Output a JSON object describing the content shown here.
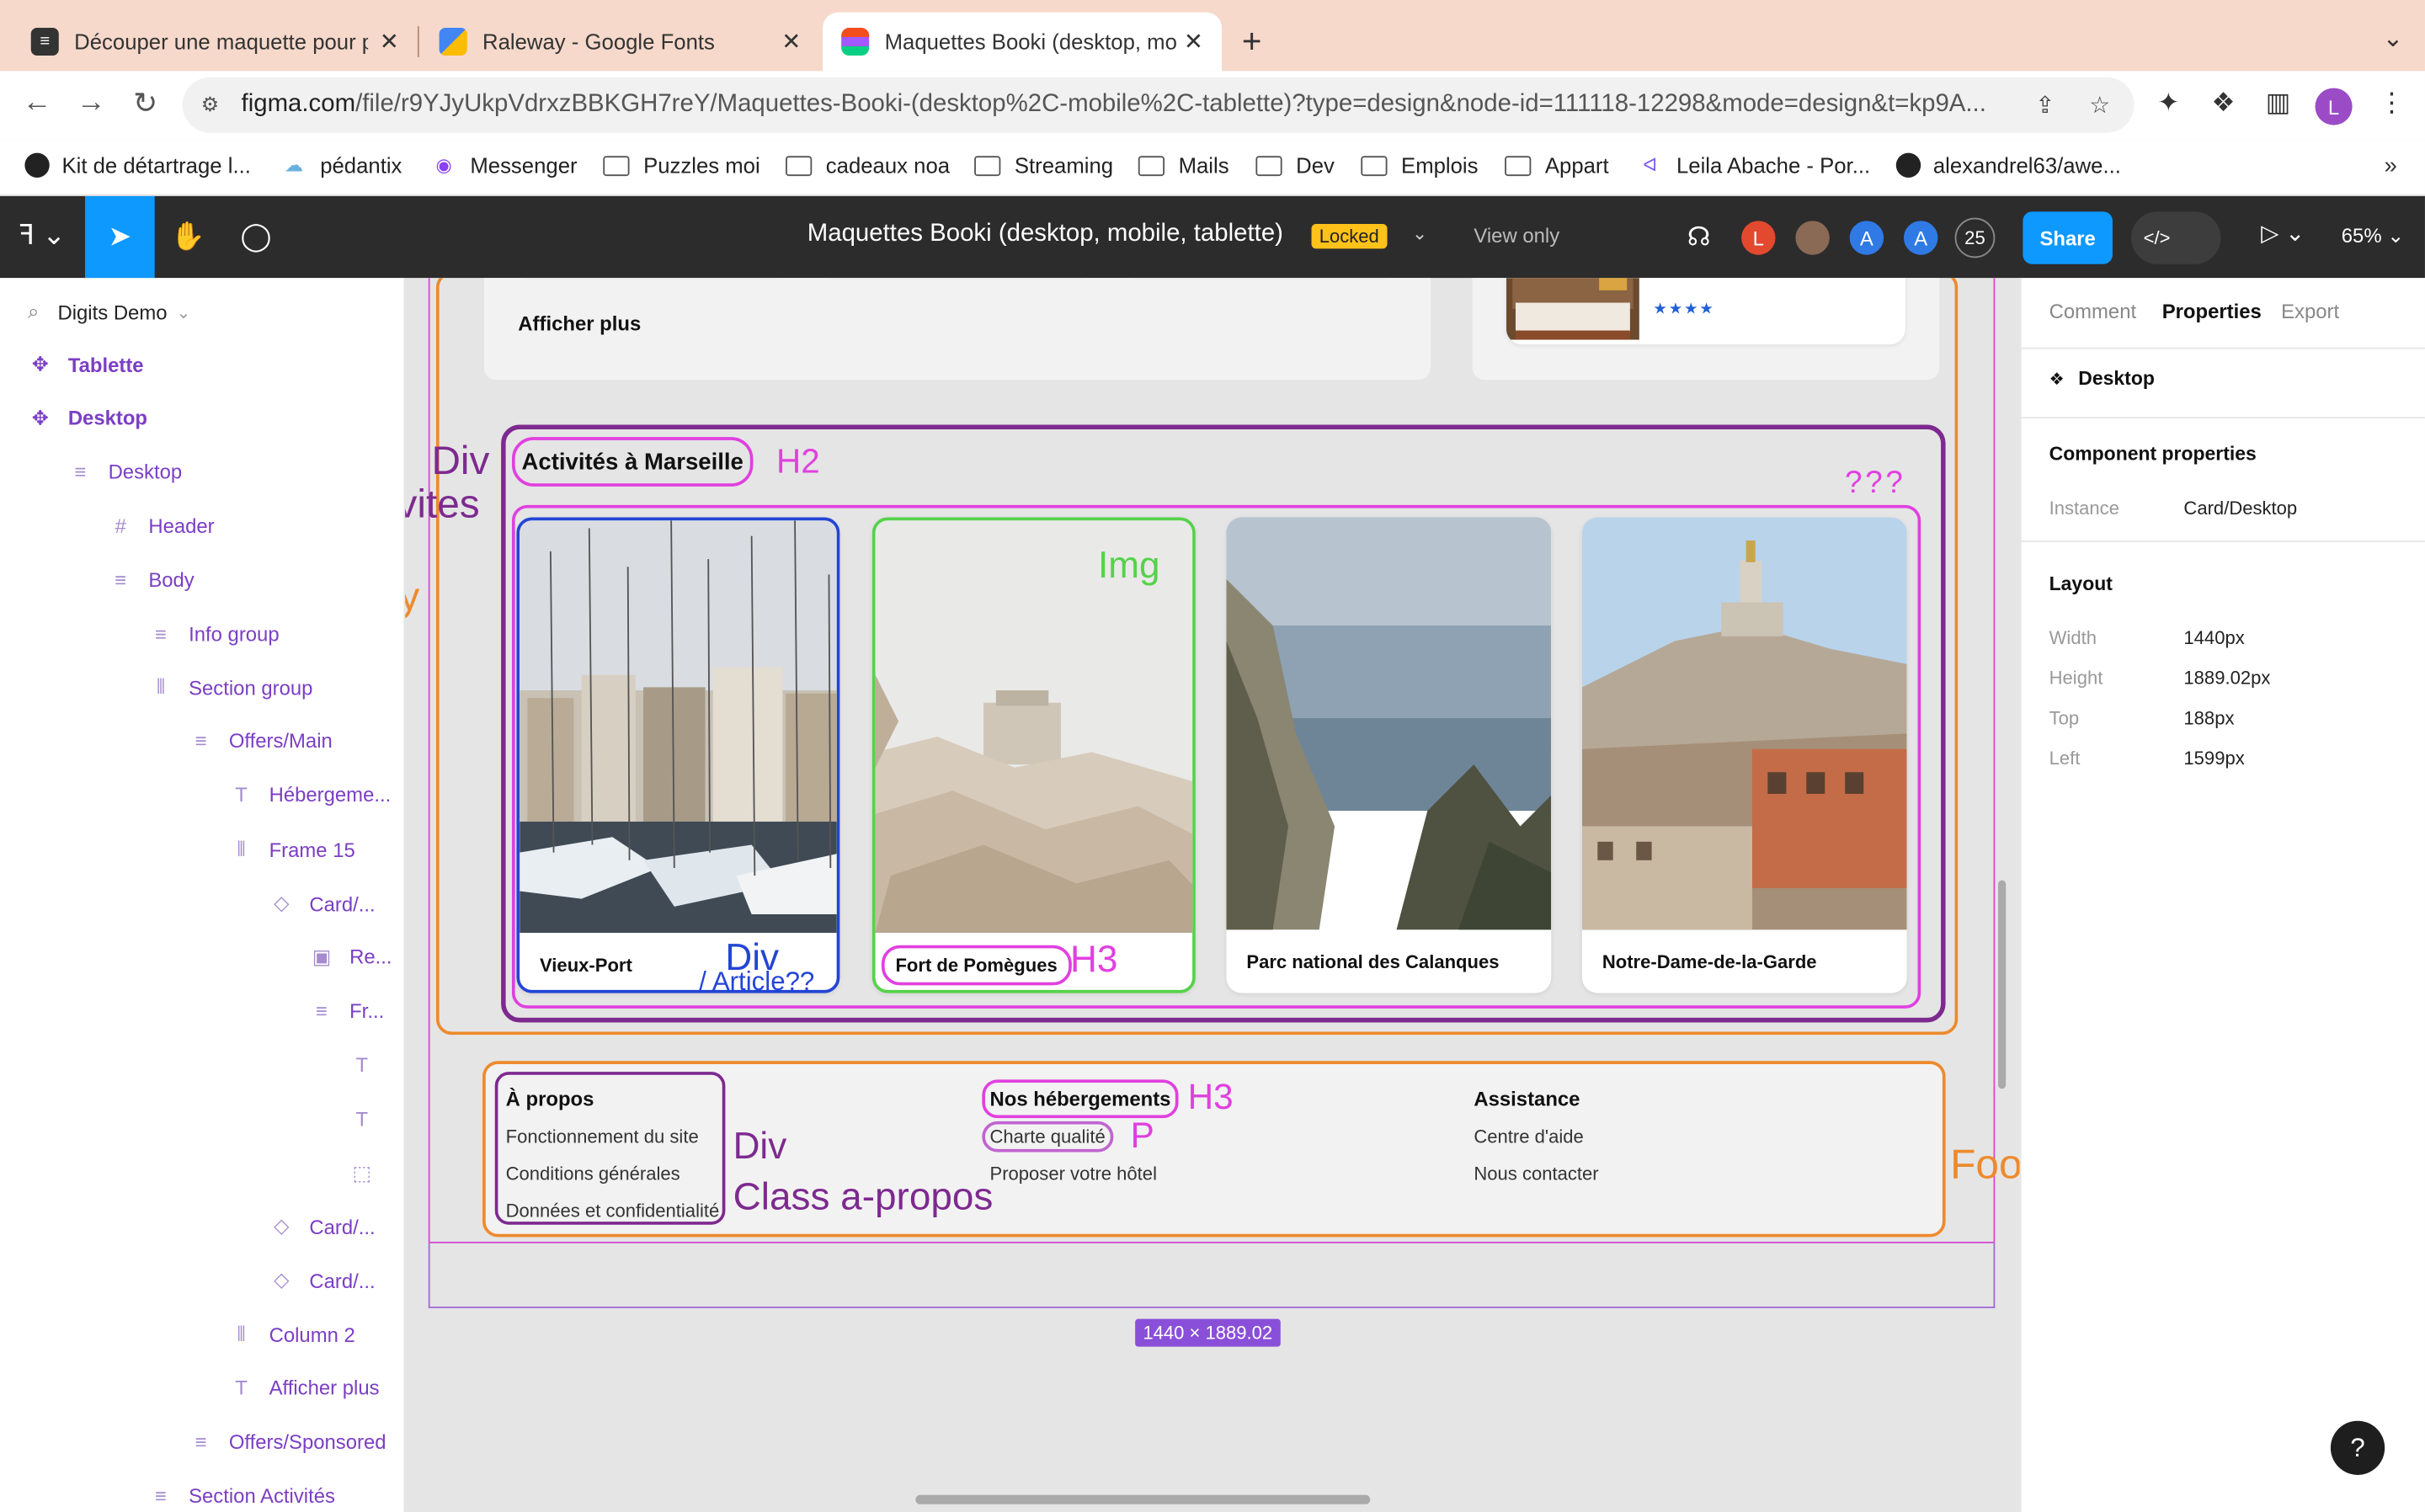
{
  "browser": {
    "tabs": [
      {
        "title": "Découper une maquette pour p",
        "favicon_color": "#333333"
      },
      {
        "title": "Raleway - Google Fonts",
        "favicon_color": "#4285f4"
      },
      {
        "title": "Maquettes Booki (desktop, mo",
        "favicon_color": "#f24e1e"
      }
    ],
    "new_tab": "+",
    "tab_menu": "⌄",
    "url_host": "figma.com",
    "url_path": "/file/r9YJyUkpVdrxzBBKGH7reY/Maquettes-Booki-(desktop%2C-mobile%2C-tablette)?type=design&node-id=111118-12298&mode=design&t=kp9A...",
    "profile_initial": "L",
    "bookmarks": [
      {
        "label": "Kit de détartrage l...",
        "kind": "site"
      },
      {
        "label": "pédantix",
        "kind": "site"
      },
      {
        "label": "Messenger",
        "kind": "site"
      },
      {
        "label": "Puzzles moi",
        "kind": "folder"
      },
      {
        "label": "cadeaux noa",
        "kind": "folder"
      },
      {
        "label": "Streaming",
        "kind": "folder"
      },
      {
        "label": "Mails",
        "kind": "folder"
      },
      {
        "label": "Dev",
        "kind": "folder"
      },
      {
        "label": "Emplois",
        "kind": "folder"
      },
      {
        "label": "Appart",
        "kind": "folder"
      },
      {
        "label": "Leila Abache - Por...",
        "kind": "site"
      },
      {
        "label": "alexandrel63/awe...",
        "kind": "site"
      }
    ],
    "bookmarks_more": "»"
  },
  "figma": {
    "file_title": "Maquettes Booki (desktop, mobile, tablette)",
    "locked_badge": "Locked",
    "view_only": "View only",
    "collaborators": [
      {
        "initial": "L",
        "color": "#e2492f"
      },
      {
        "initial": "",
        "color": "#8a6a55"
      },
      {
        "initial": "A",
        "color": "#2f7ae5"
      },
      {
        "initial": "A",
        "color": "#2f7ae5"
      }
    ],
    "collaborator_count": "25",
    "share_label": "Share",
    "devmode_icon": "</>",
    "zoom": "65%"
  },
  "layers": {
    "page_picker": "Digits Demo",
    "items": [
      {
        "label": "Tablette",
        "icon": "component-icon"
      },
      {
        "label": "Desktop",
        "icon": "component-icon"
      },
      {
        "label": "Desktop",
        "icon": "autolayout-vertical-icon"
      },
      {
        "label": "Header",
        "icon": "frame-icon"
      },
      {
        "label": "Body",
        "icon": "autolayout-vertical-icon"
      },
      {
        "label": "Info group",
        "icon": "autolayout-vertical-icon"
      },
      {
        "label": "Section group",
        "icon": "autolayout-horizontal-icon"
      },
      {
        "label": "Offers/Main",
        "icon": "autolayout-vertical-icon"
      },
      {
        "label": "Hébergeme...",
        "icon": "text-icon"
      },
      {
        "label": "Frame 15",
        "icon": "autolayout-horizontal-icon"
      },
      {
        "label": "Card/...",
        "icon": "instance-icon"
      },
      {
        "label": "Re...",
        "icon": "image-icon"
      },
      {
        "label": "Fr...",
        "icon": "autolayout-vertical-icon"
      },
      {
        "label": "",
        "icon": "text-icon"
      },
      {
        "label": "",
        "icon": "text-icon"
      },
      {
        "label": "",
        "icon": "dashed-frame-icon"
      },
      {
        "label": "Card/...",
        "icon": "instance-icon"
      },
      {
        "label": "Card/...",
        "icon": "instance-icon"
      },
      {
        "label": "Column 2",
        "icon": "autolayout-horizontal-icon"
      },
      {
        "label": "Afficher plus",
        "icon": "text-icon"
      },
      {
        "label": "Offers/Sponsored",
        "icon": "autolayout-vertical-icon"
      },
      {
        "label": "Section Activités",
        "icon": "autolayout-vertical-icon"
      }
    ]
  },
  "canvas": {
    "afficher_plus": "Afficher plus",
    "section_title": "Activités à Marseille",
    "cards": [
      {
        "title": "Vieux-Port",
        "photo": "harbor-boats-image"
      },
      {
        "title": "Fort de Pomègues",
        "photo": "rocky-fort-image"
      },
      {
        "title": "Parc national des Calanques",
        "photo": "calanques-cliffs-image"
      },
      {
        "title": "Notre-Dame-de-la-Garde",
        "photo": "basilica-hill-image"
      }
    ],
    "rating_stars": "★★★★",
    "footer": {
      "columns": [
        {
          "heading": "À propos",
          "links": [
            "Fonctionnement du site",
            "Conditions générales",
            "Données et confidentialité"
          ]
        },
        {
          "heading": "Nos hébergements",
          "links": [
            "Charte qualité",
            "Proposer votre hôtel"
          ]
        },
        {
          "heading": "Assistance",
          "links": [
            "Centre d'aide",
            "Nous contacter"
          ]
        }
      ]
    },
    "dimension_badge": "1440 × 1889.02",
    "annotations": {
      "div_left": "Div",
      "class_activites": "Class activites",
      "body": "Body",
      "h2": "H2",
      "qqq": "???",
      "img": "Img",
      "div_article_1": "Div",
      "div_article_2": "/ Article??",
      "h3_card": "H3",
      "h3_footer": "H3",
      "p_footer": "P",
      "div_footer": "Div",
      "class_apropos": "Class a-propos",
      "footer": "Footer"
    },
    "annotation_colors": {
      "purple": "#7d2a8f",
      "magenta": "#e040e0",
      "orange": "#ee8a2c",
      "green": "#55d24a",
      "blue": "#2345d6"
    }
  },
  "properties": {
    "tabs": [
      "Comment",
      "Properties",
      "Export"
    ],
    "active_tab": "Properties",
    "selection": "Desktop",
    "component_props_heading": "Component properties",
    "instance_label": "Instance",
    "instance_value": "Card/Desktop",
    "layout_heading": "Layout",
    "layout": [
      {
        "label": "Width",
        "value": "1440px"
      },
      {
        "label": "Height",
        "value": "1889.02px"
      },
      {
        "label": "Top",
        "value": "188px"
      },
      {
        "label": "Left",
        "value": "1599px"
      }
    ],
    "help": "?"
  }
}
